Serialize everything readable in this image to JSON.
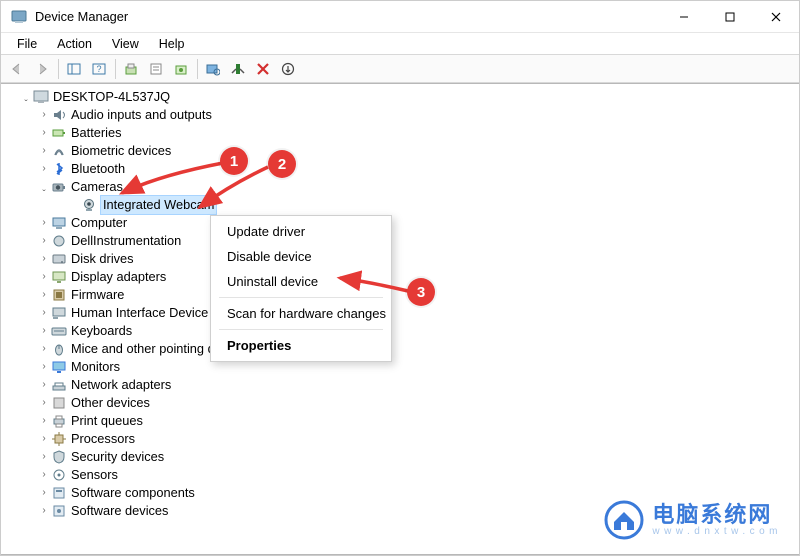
{
  "window": {
    "title": "Device Manager"
  },
  "menubar": {
    "file": "File",
    "action": "Action",
    "view": "View",
    "help": "Help"
  },
  "tree": {
    "root": "DESKTOP-4L537JQ",
    "categories": [
      "Audio inputs and outputs",
      "Batteries",
      "Biometric devices",
      "Bluetooth",
      "Cameras",
      "Computer",
      "DellInstrumentation",
      "Disk drives",
      "Display adapters",
      "Firmware",
      "Human Interface Device",
      "Keyboards",
      "Mice and other pointing devices",
      "Monitors",
      "Network adapters",
      "Other devices",
      "Print queues",
      "Processors",
      "Security devices",
      "Sensors",
      "Software components",
      "Software devices"
    ],
    "expanded_category_index": 4,
    "selected_device": "Integrated Webcam"
  },
  "context_menu": {
    "items": [
      "Update driver",
      "Disable device",
      "Uninstall device"
    ],
    "scan": "Scan for hardware changes",
    "properties": "Properties"
  },
  "callouts": {
    "c1": "1",
    "c2": "2",
    "c3": "3"
  },
  "watermark": {
    "cn": "电脑系统网",
    "url": "www.dnxtw.com"
  },
  "colors": {
    "accent": "#e53935",
    "select_bg": "#cde8ff",
    "brand": "#3a7ad9"
  }
}
